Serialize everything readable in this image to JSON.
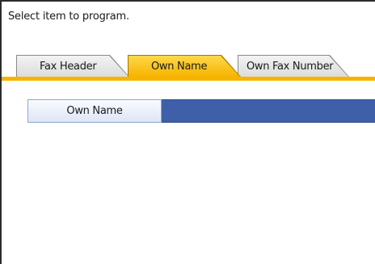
{
  "prompt": "Select item to program.",
  "tabs": [
    {
      "label": "Fax Header",
      "selected": false
    },
    {
      "label": "Own Name",
      "selected": true
    },
    {
      "label": "Own Fax Number",
      "selected": false
    }
  ],
  "field": {
    "label": "Own Name",
    "value": ""
  },
  "colors": {
    "active_tab": "#f6b400",
    "value_field": "#3f5fa9"
  }
}
